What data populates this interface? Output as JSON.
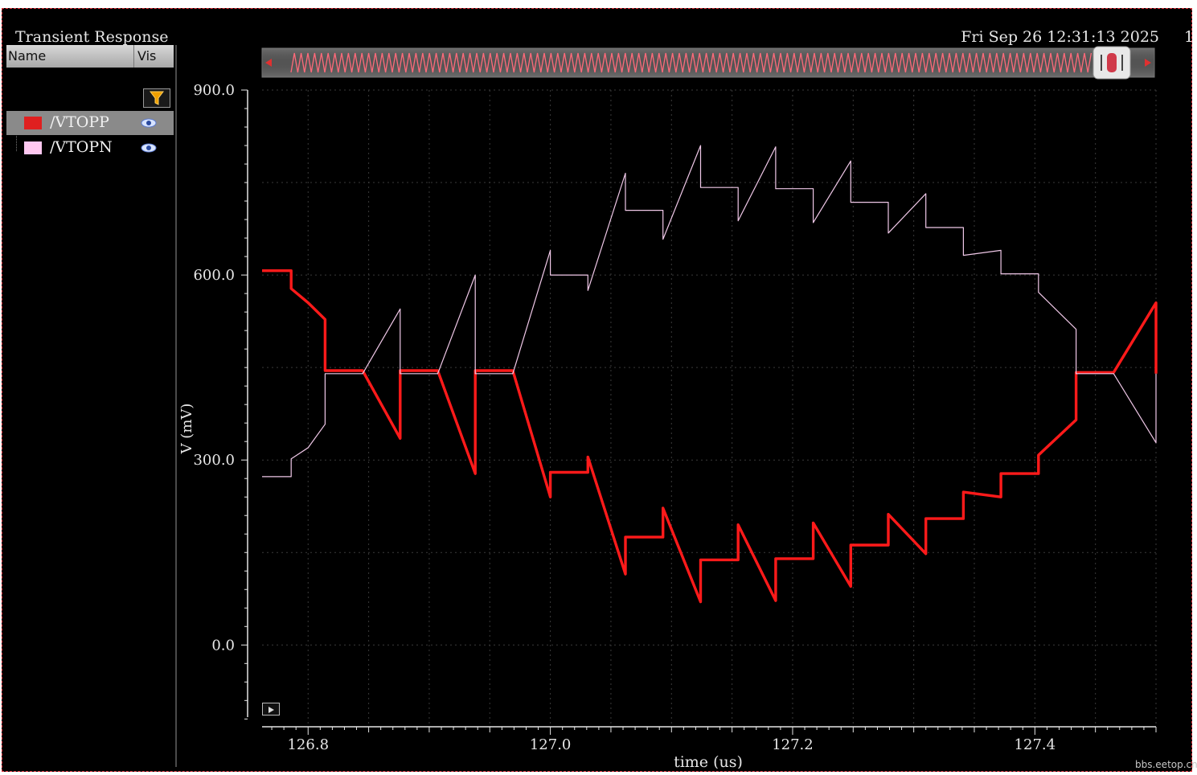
{
  "window": {
    "title": "Transient Response",
    "date": "Fri Sep 26 12:31:13 2025",
    "page_number": "1"
  },
  "legend": {
    "col_name": "Name",
    "col_vis": "Vis",
    "items": [
      {
        "label": "/VTOPP",
        "color": "#e02020",
        "selected": true
      },
      {
        "label": "/VTOPN",
        "color": "#ffc8f0",
        "selected": false
      }
    ]
  },
  "watermark": "bbs.eetop.cn",
  "chart_data": {
    "type": "line",
    "xlabel": "time (us)",
    "ylabel": "V (mV)",
    "xlim": [
      126.762,
      127.5
    ],
    "ylim": [
      -130,
      900
    ],
    "xticks": [
      126.8,
      127.0,
      127.2,
      127.4
    ],
    "xtick_labels": [
      "126.8",
      "127.0",
      "127.2",
      "127.4"
    ],
    "yticks": [
      900,
      600,
      300,
      0
    ],
    "ytick_labels": [
      "900.0",
      "600.0",
      "300.0",
      "0.0"
    ],
    "grid": true,
    "series": [
      {
        "name": "/VTOPP",
        "color": "#ff1a1a",
        "points": [
          [
            126.762,
            607
          ],
          [
            126.786,
            607
          ],
          [
            126.786,
            578
          ],
          [
            126.8,
            555
          ],
          [
            126.814,
            528
          ],
          [
            126.814,
            445
          ],
          [
            126.845,
            445
          ],
          [
            126.876,
            335
          ],
          [
            126.876,
            445
          ],
          [
            126.907,
            445
          ],
          [
            126.938,
            278
          ],
          [
            126.938,
            445
          ],
          [
            126.969,
            445
          ],
          [
            127.0,
            240
          ],
          [
            127.0,
            280
          ],
          [
            127.031,
            280
          ],
          [
            127.031,
            305
          ],
          [
            127.062,
            115
          ],
          [
            127.062,
            175
          ],
          [
            127.093,
            175
          ],
          [
            127.093,
            222
          ],
          [
            127.124,
            70
          ],
          [
            127.124,
            138
          ],
          [
            127.155,
            138
          ],
          [
            127.155,
            195
          ],
          [
            127.186,
            72
          ],
          [
            127.186,
            140
          ],
          [
            127.217,
            140
          ],
          [
            127.217,
            198
          ],
          [
            127.248,
            95
          ],
          [
            127.248,
            162
          ],
          [
            127.279,
            162
          ],
          [
            127.279,
            212
          ],
          [
            127.31,
            148
          ],
          [
            127.31,
            205
          ],
          [
            127.341,
            205
          ],
          [
            127.341,
            248
          ],
          [
            127.372,
            240
          ],
          [
            127.372,
            278
          ],
          [
            127.403,
            278
          ],
          [
            127.403,
            308
          ],
          [
            127.434,
            365
          ],
          [
            127.434,
            442
          ],
          [
            127.465,
            442
          ],
          [
            127.5,
            555
          ],
          [
            127.5,
            440
          ]
        ]
      },
      {
        "name": "/VTOPN",
        "color": "#f0c8e8",
        "points": [
          [
            126.762,
            273
          ],
          [
            126.786,
            273
          ],
          [
            126.786,
            302
          ],
          [
            126.8,
            320
          ],
          [
            126.814,
            358
          ],
          [
            126.814,
            440
          ],
          [
            126.845,
            440
          ],
          [
            126.876,
            545
          ],
          [
            126.876,
            440
          ],
          [
            126.907,
            440
          ],
          [
            126.938,
            600
          ],
          [
            126.938,
            440
          ],
          [
            126.969,
            440
          ],
          [
            127.0,
            640
          ],
          [
            127.0,
            600
          ],
          [
            127.031,
            600
          ],
          [
            127.031,
            575
          ],
          [
            127.062,
            765
          ],
          [
            127.062,
            705
          ],
          [
            127.093,
            705
          ],
          [
            127.093,
            658
          ],
          [
            127.124,
            810
          ],
          [
            127.124,
            742
          ],
          [
            127.155,
            742
          ],
          [
            127.155,
            688
          ],
          [
            127.186,
            808
          ],
          [
            127.186,
            740
          ],
          [
            127.217,
            740
          ],
          [
            127.217,
            685
          ],
          [
            127.248,
            785
          ],
          [
            127.248,
            718
          ],
          [
            127.279,
            718
          ],
          [
            127.279,
            668
          ],
          [
            127.31,
            732
          ],
          [
            127.31,
            677
          ],
          [
            127.341,
            677
          ],
          [
            127.341,
            632
          ],
          [
            127.372,
            640
          ],
          [
            127.372,
            602
          ],
          [
            127.403,
            602
          ],
          [
            127.403,
            572
          ],
          [
            127.434,
            512
          ],
          [
            127.434,
            440
          ],
          [
            127.465,
            440
          ],
          [
            127.5,
            328
          ],
          [
            127.5,
            440
          ]
        ]
      }
    ]
  }
}
